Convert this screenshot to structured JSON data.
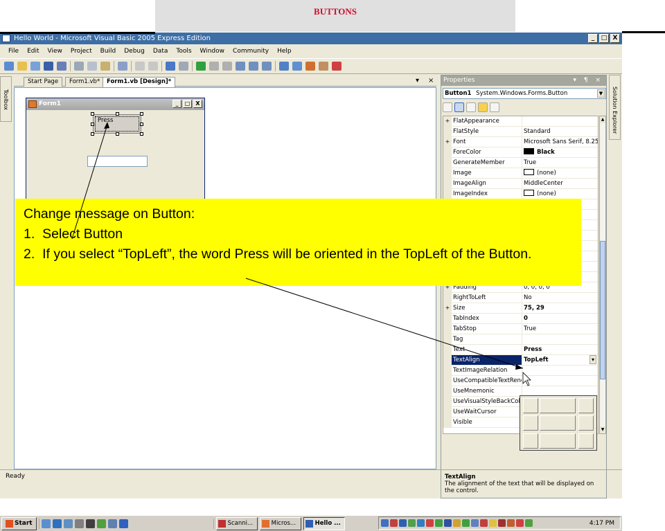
{
  "slide": {
    "title": "BUTTONS"
  },
  "window": {
    "title": "Hello World - Microsoft Visual Basic 2005 Express Edition",
    "controls": {
      "min": "_",
      "max": "□",
      "close": "X"
    }
  },
  "menu": [
    "File",
    "Edit",
    "View",
    "Project",
    "Build",
    "Debug",
    "Data",
    "Tools",
    "Window",
    "Community",
    "Help"
  ],
  "toolbox": {
    "label": "Toolbox"
  },
  "tabs": [
    {
      "label": "Start Page",
      "active": false
    },
    {
      "label": "Form1.vb*",
      "active": false
    },
    {
      "label": "Form1.vb [Design]*",
      "active": true
    }
  ],
  "tab_controls": {
    "dropdown": "▾",
    "close": "×"
  },
  "form": {
    "title": "Form1",
    "button_text": "Press",
    "controls": {
      "min": "_",
      "max": "□",
      "close": "X"
    }
  },
  "properties": {
    "panel_title": "Properties",
    "panel_controls": "▾ ¶ ×",
    "object_name": "Button1",
    "object_type": "System.Windows.Forms.Button",
    "rows": [
      {
        "expand": "+",
        "name": "FlatAppearance",
        "value": ""
      },
      {
        "expand": "",
        "name": "FlatStyle",
        "value": "Standard"
      },
      {
        "expand": "+",
        "name": "Font",
        "value": "Microsoft Sans Serif, 8.25pt"
      },
      {
        "expand": "",
        "name": "ForeColor",
        "value": "Black",
        "swatch": "#000000",
        "bold": true
      },
      {
        "expand": "",
        "name": "GenerateMember",
        "value": "True"
      },
      {
        "expand": "",
        "name": "Image",
        "value": "(none)",
        "swatch": "#ffffff"
      },
      {
        "expand": "",
        "name": "ImageAlign",
        "value": "MiddleCenter"
      },
      {
        "expand": "",
        "name": "ImageIndex",
        "value": "(none)",
        "swatch": "#ffffff"
      },
      {
        "expand": "",
        "name": "",
        "value": ""
      },
      {
        "expand": "",
        "name": "",
        "value": ""
      },
      {
        "expand": "",
        "name": "",
        "value": ""
      },
      {
        "expand": "",
        "name": "",
        "value": ""
      },
      {
        "expand": "",
        "name": "",
        "value": ""
      },
      {
        "expand": "",
        "name": "",
        "value": ""
      },
      {
        "expand": "",
        "name": "",
        "value": ""
      },
      {
        "expand": "",
        "name": "",
        "value": ""
      },
      {
        "expand": "+",
        "name": "Padding",
        "value": "0, 0, 0, 0"
      },
      {
        "expand": "",
        "name": "RightToLeft",
        "value": "No"
      },
      {
        "expand": "+",
        "name": "Size",
        "value": "75, 29",
        "bold": true
      },
      {
        "expand": "",
        "name": "TabIndex",
        "value": "0",
        "bold": true
      },
      {
        "expand": "",
        "name": "TabStop",
        "value": "True"
      },
      {
        "expand": "",
        "name": "Tag",
        "value": ""
      },
      {
        "expand": "",
        "name": "Text",
        "value": "Press",
        "bold": true
      },
      {
        "expand": "",
        "name": "TextAlign",
        "value": "TopLeft",
        "bold": true,
        "selected": true
      },
      {
        "expand": "",
        "name": "TextImageRelation",
        "value": ""
      },
      {
        "expand": "",
        "name": "UseCompatibleTextRendering",
        "value": ""
      },
      {
        "expand": "",
        "name": "UseMnemonic",
        "value": ""
      },
      {
        "expand": "",
        "name": "UseVisualStyleBackColor",
        "value": ""
      },
      {
        "expand": "",
        "name": "UseWaitCursor",
        "value": ""
      },
      {
        "expand": "",
        "name": "Visible",
        "value": "True"
      }
    ],
    "description_title": "TextAlign",
    "description_text": "The alignment of the text that will be displayed on the control."
  },
  "solution_explorer": {
    "label": "Solution Explorer"
  },
  "status": "Ready",
  "taskbar": {
    "start": "Start",
    "tasks": [
      {
        "label": "Scanni...",
        "active": false
      },
      {
        "label": "Micros...",
        "active": false
      },
      {
        "label": "Hello ...",
        "active": true
      }
    ],
    "clock": "4:17 PM"
  },
  "callout": {
    "heading": "Change message on Button:",
    "items": [
      "1.  Select Button",
      "2.  If you select “TopLeft”, the word Press will be oriented in the TopLeft of the Button."
    ]
  }
}
